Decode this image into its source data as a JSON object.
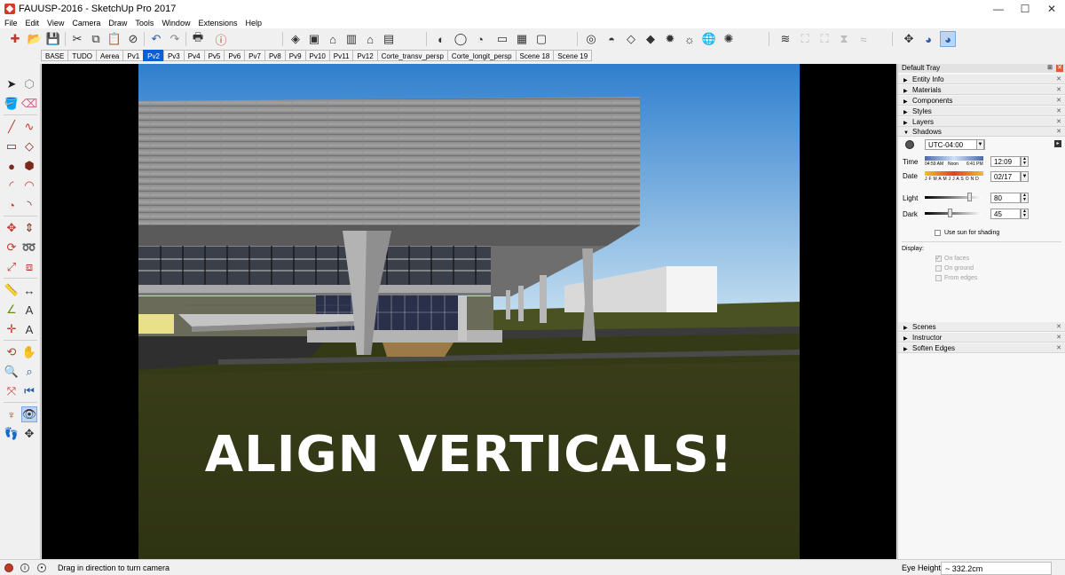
{
  "window": {
    "title": "FAUUSP-2016 - SketchUp Pro 2017",
    "minimize": "—",
    "maximize": "☐",
    "close": "✕"
  },
  "menu": [
    "File",
    "Edit",
    "View",
    "Camera",
    "Draw",
    "Tools",
    "Window",
    "Extensions",
    "Help"
  ],
  "toolbar_icons": {
    "new": "✚",
    "open": "📂",
    "save": "💾",
    "cut": "✂",
    "copy": "⧉",
    "paste": "📋",
    "erase": "⊘",
    "undo": "↶",
    "redo": "↷",
    "print": "🖶",
    "model_info": "ⓘ",
    "iso": "◈",
    "top": "▣",
    "front": "⌂",
    "right": "▥",
    "back": "⌂",
    "left": "▤",
    "xray": "◐",
    "wireframe": "◯",
    "hiddenline": "◔",
    "shaded": "▭",
    "textured": "▦",
    "monochrome": "▢",
    "geo": "◎",
    "warehouse": "◓",
    "component": "◇",
    "extension": "◆",
    "photo": "✹",
    "sun": "☼",
    "globe": "🌐",
    "settings": "✺",
    "sandbox1": "≋",
    "sandbox2": "⛶",
    "sandbox3": "⛶",
    "sandbox4": "⧗",
    "sandbox5": "≈",
    "position_camera": "✥",
    "look_around": "◕",
    "walk": "◕"
  },
  "scenes": [
    "BASE",
    "TUDO",
    "Aerea",
    "Pv1",
    "Pv2",
    "Pv3",
    "Pv4",
    "Pv5",
    "Pv6",
    "Pv7",
    "Pv8",
    "Pv9",
    "Pv10",
    "Pv11",
    "Pv12",
    "Corte_transv_persp",
    "Corte_longit_persp",
    "Scene 18",
    "Scene 19"
  ],
  "active_scene": "Pv2",
  "left_icons": {
    "select": "➤",
    "make_component": "⬡",
    "paint": "🪣",
    "eraser": "⌫",
    "line": "╱",
    "freehand": "∿",
    "rectangle": "▭",
    "rotated_rect": "◇",
    "circle": "●",
    "polygon": "⬢",
    "arc": "◜",
    "arc2": "◠",
    "pie": "◔",
    "arc3": "◝",
    "move": "✥",
    "push_pull": "⇕",
    "rotate": "⟳",
    "follow_me": "➿",
    "scale": "⤢",
    "offset": "⧈",
    "tape": "📏",
    "dimension": "↔",
    "protractor": "∠",
    "text": "A",
    "axes": "✛",
    "3d_text": "A",
    "orbit": "⟲",
    "pan": "✋",
    "zoom": "🔍",
    "zoom_window": "⌕",
    "zoom_extents": "⤧",
    "previous": "⏮",
    "position_camera": "♆",
    "look_around": "👁",
    "walk": "👣",
    "section_plane": "✥"
  },
  "overlay_text": "ALIGN VERTICALS!",
  "tray": {
    "title": "Default Tray",
    "pin": "⊞",
    "close": "✕",
    "panels": {
      "entity_info": "Entity Info",
      "materials": "Materials",
      "components": "Components",
      "styles": "Styles",
      "layers": "Layers",
      "shadows": "Shadows",
      "scenes": "Scenes",
      "instructor": "Instructor",
      "soften_edges": "Soften Edges"
    },
    "collapsed_arrow": "▶",
    "expanded_arrow": "▼",
    "panel_close": "✕",
    "shadows": {
      "timezone": "UTC-04:00",
      "time_label": "Time",
      "time_start": "04:59 AM",
      "time_noon": "Noon",
      "time_end": "6:41 PM",
      "time_value": "12:09",
      "date_label": "Date",
      "months": "J F M A M J J A S O N D",
      "date_value": "02/17",
      "light_label": "Light",
      "light_value": "80",
      "light_level": 0.8,
      "dark_label": "Dark",
      "dark_value": "45",
      "dark_level": 0.45,
      "use_sun": "Use sun for shading",
      "display_label": "Display:",
      "on_faces": "On faces",
      "on_ground": "On ground",
      "from_edges": "From edges"
    }
  },
  "status": {
    "message": "Drag in direction to turn camera",
    "vcb_label": "Eye Height",
    "vcb_value": "~ 332.2cm"
  },
  "colors": {
    "sky_top": "#2f7fce",
    "sky_bottom": "#cbe3f2",
    "ground": "#3a3f1a",
    "concrete": "#9a9a9a",
    "accent": "#0a5fd6"
  }
}
